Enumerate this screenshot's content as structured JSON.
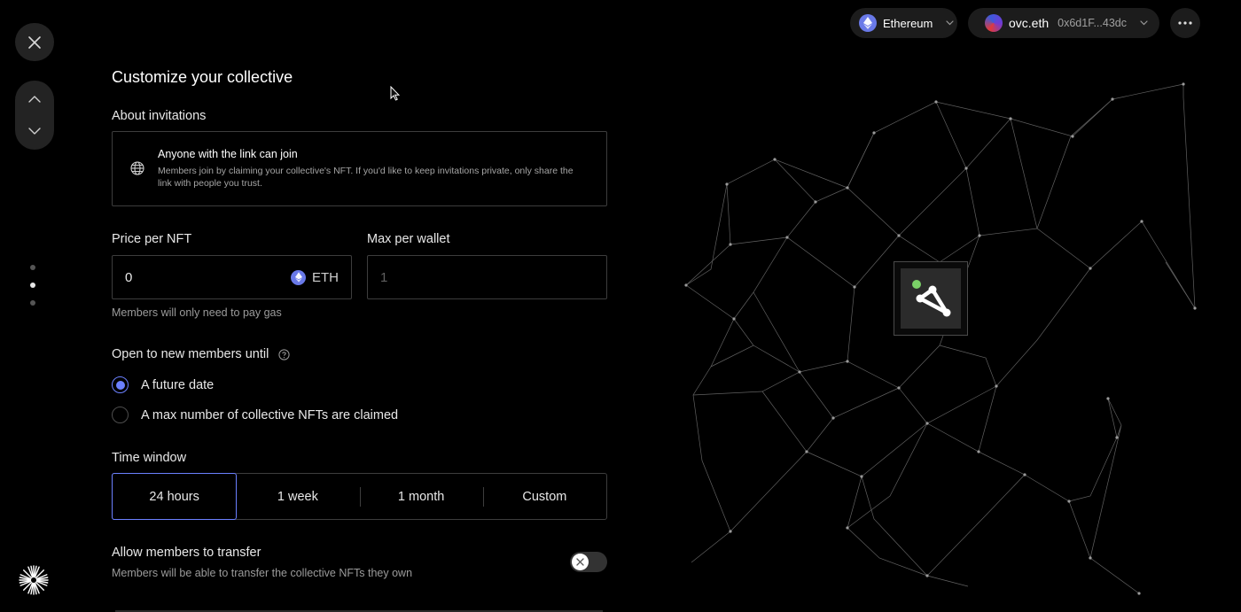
{
  "header": {
    "network": {
      "label": "Ethereum",
      "icon": "ethereum-icon"
    },
    "account": {
      "name": "ovc.eth",
      "address": "0x6d1F...43dc",
      "avatar": "gradient-avatar"
    },
    "more_icon": "more-horizontal-icon"
  },
  "rail": {
    "close_icon": "close-icon",
    "up_icon": "chevron-up-icon",
    "down_icon": "chevron-down-icon",
    "steps": 3,
    "active_step": 2,
    "brand_icon": "starburst-logo-icon"
  },
  "form": {
    "title": "Customize your collective",
    "invitations": {
      "label": "About invitations",
      "title": "Anyone with the link can join",
      "description": "Members join by claiming your collective's NFT. If you'd like to keep invitations private, only share the link with people you trust.",
      "icon": "globe-icon"
    },
    "price": {
      "label": "Price per NFT",
      "value": "0",
      "currency": "ETH",
      "hint": "Members will only need to pay gas"
    },
    "max_per_wallet": {
      "label": "Max per wallet",
      "placeholder": "1"
    },
    "open_until": {
      "label": "Open to new members until",
      "options": [
        {
          "label": "A future date",
          "checked": true
        },
        {
          "label": "A max number of collective NFTs are claimed",
          "checked": false
        }
      ]
    },
    "time_window": {
      "label": "Time window",
      "options": [
        "24 hours",
        "1 week",
        "1 month",
        "Custom"
      ],
      "selected": "24 hours"
    },
    "transfer": {
      "label": "Allow members to transfer",
      "description": "Members will be able to transfer the collective NFTs they own",
      "enabled": false
    }
  },
  "colors": {
    "accent": "#6b80ff",
    "ethereum": "#6979e8",
    "logo_dot": "#7ad067"
  }
}
